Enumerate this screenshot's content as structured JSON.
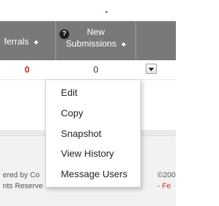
{
  "table": {
    "headers": {
      "referrals": "ferrals",
      "new_submissions_line1": "New",
      "new_submissions_line2": "Submissions",
      "sort_glyph": "◆"
    },
    "help_icon_glyph": "?",
    "rows": [
      {
        "referrals": "0",
        "new_submissions": "0"
      }
    ],
    "colors": {
      "header_bg": "#797979",
      "referrals_value": "#cc1f1f"
    }
  },
  "context_menu": {
    "items": [
      {
        "label": "Edit"
      },
      {
        "label": "Copy"
      },
      {
        "label": "Snapshot"
      },
      {
        "label": "View History"
      },
      {
        "label": "Message Users"
      }
    ]
  },
  "footer": {
    "left_line1": "ered by Co",
    "left_line2": "nts Reserve",
    "right_line1": "©200",
    "right_line2_prefix": "- ",
    "right_line2_link": "Fe"
  }
}
